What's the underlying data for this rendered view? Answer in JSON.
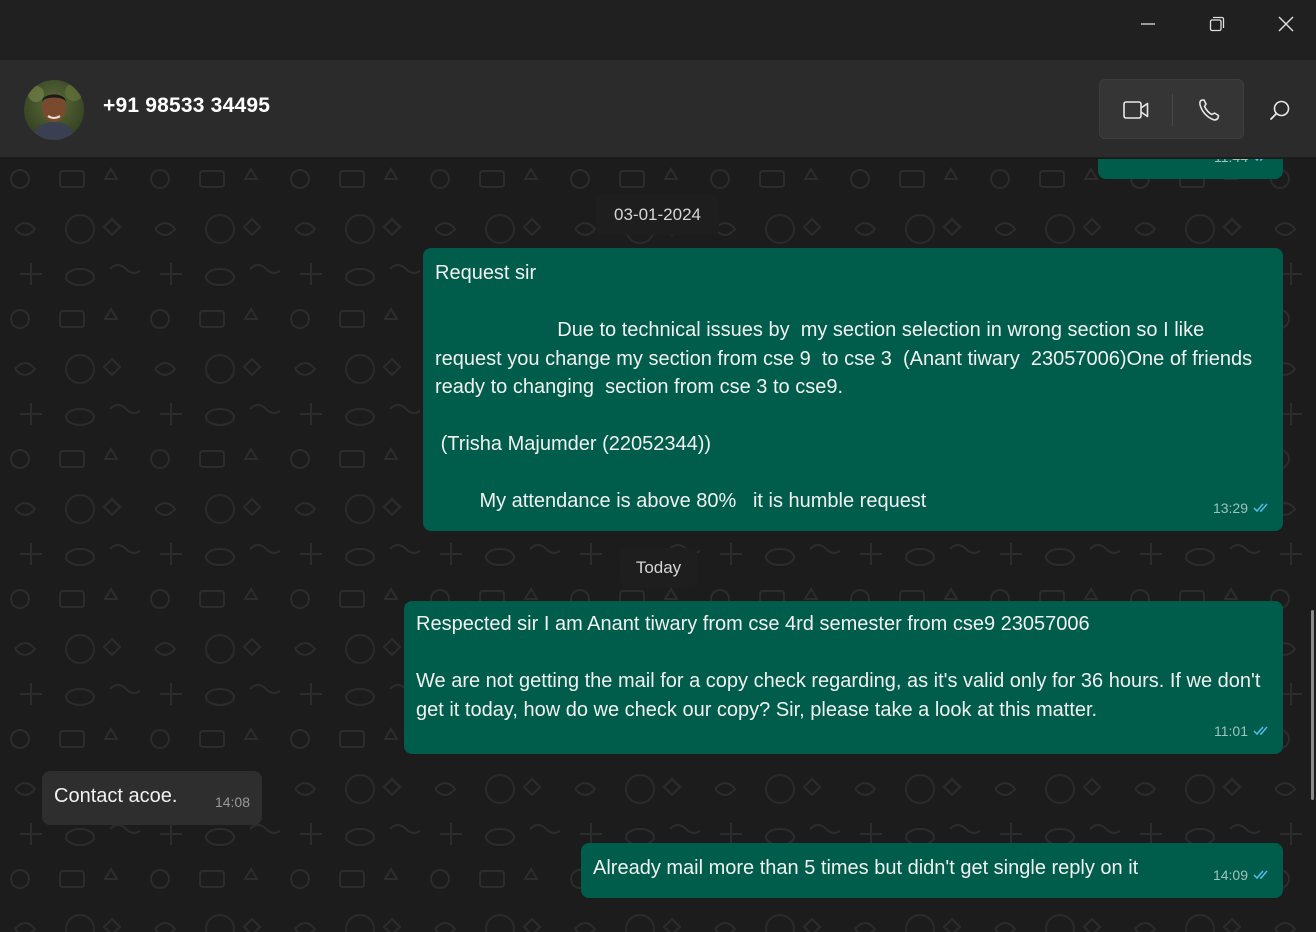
{
  "window": {
    "minimize_icon": "minimize-icon",
    "restore_icon": "restore-icon",
    "close_icon": "close-icon"
  },
  "header": {
    "contact_name": "+91 98533 34495",
    "video_icon": "video-call-icon",
    "voice_icon": "voice-call-icon",
    "search_icon": "search-icon"
  },
  "colors": {
    "outgoing_bubble": "#005c4b",
    "incoming_bubble": "#2e2e2e",
    "read_ticks": "#53bdeb"
  },
  "chat": {
    "top_partial_time": "11:44",
    "date_1": "03-01-2024",
    "date_2": "Today",
    "messages": [
      {
        "direction": "outgoing",
        "text": "Request sir\n\n                      Due to technical issues by  my section selection in wrong section so I like request you change my section from cse 9  to cse 3  (Anant tiwary  23057006)One of friends ready to changing  section from cse 3 to cse9.\n\n (Trisha Majumder (22052344))\n\n        My attendance is above 80%   it is humble request",
        "time": "13:29",
        "status": "read"
      },
      {
        "direction": "outgoing",
        "text": "Respected sir I am Anant tiwary from cse 4rd semester from cse9 23057006\n\nWe are not getting the mail for a copy check regarding, as it's valid only for 36 hours. If we don't get it today, how do we check our copy? Sir, please take a look at this matter.",
        "time": "11:01",
        "status": "read"
      },
      {
        "direction": "incoming",
        "text": "Contact acoe.",
        "time": "14:08"
      },
      {
        "direction": "outgoing",
        "text": "Already mail more than 5 times but didn't get single reply on it",
        "time": "14:09",
        "status": "read"
      }
    ]
  }
}
